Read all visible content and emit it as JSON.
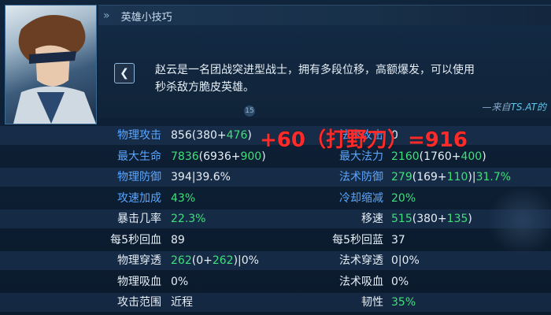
{
  "tips": {
    "header_title": "英雄小技巧",
    "description_line1": "赵云是一名团战突进型战士，拥有多段位移，高额爆发，可以使用",
    "description_line2": "秒杀敌方脆皮英雄。",
    "source_prefix": "—来自",
    "source_name": "TS.AT的",
    "badge": "15"
  },
  "overlay_note": "+60（打野刀）=916",
  "stats": {
    "rows": [
      {
        "label_l": "物理攻击",
        "label_l_color": "blue",
        "val_l": [
          [
            "856(380+",
            "white"
          ],
          [
            "476",
            "green"
          ],
          [
            ")",
            "white"
          ]
        ],
        "label_r": "法术攻击",
        "label_r_color": "blue",
        "val_r": [
          [
            "0",
            "white"
          ]
        ]
      },
      {
        "label_l": "最大生命",
        "label_l_color": "blue",
        "val_l": [
          [
            "7836",
            "green"
          ],
          [
            "(6936+",
            "white"
          ],
          [
            "900",
            "green"
          ],
          [
            ")",
            "white"
          ]
        ],
        "label_r": "最大法力",
        "label_r_color": "blue",
        "val_r": [
          [
            "2160",
            "green"
          ],
          [
            "(1760+",
            "white"
          ],
          [
            "400",
            "green"
          ],
          [
            ")",
            "white"
          ]
        ]
      },
      {
        "label_l": "物理防御",
        "label_l_color": "blue",
        "val_l": [
          [
            "394|39.6%",
            "white"
          ]
        ],
        "label_r": "法术防御",
        "label_r_color": "blue",
        "val_r": [
          [
            "279",
            "green"
          ],
          [
            "(169+",
            "white"
          ],
          [
            "110",
            "green"
          ],
          [
            ")|",
            "white"
          ],
          [
            "31.7%",
            "green"
          ]
        ]
      },
      {
        "label_l": "攻速加成",
        "label_l_color": "blue",
        "val_l": [
          [
            "43%",
            "green"
          ]
        ],
        "label_r": "冷却缩减",
        "label_r_color": "blue",
        "val_r": [
          [
            "20%",
            "green"
          ]
        ]
      },
      {
        "label_l": "暴击几率",
        "label_l_color": "white",
        "val_l": [
          [
            "22.3%",
            "green"
          ]
        ],
        "label_r": "移速",
        "label_r_color": "white",
        "val_r": [
          [
            "515",
            "green"
          ],
          [
            "(380+",
            "white"
          ],
          [
            "135",
            "green"
          ],
          [
            ")",
            "white"
          ]
        ]
      },
      {
        "label_l": "每5秒回血",
        "label_l_color": "white",
        "val_l": [
          [
            "89",
            "white"
          ]
        ],
        "label_r": "每5秒回蓝",
        "label_r_color": "white",
        "val_r": [
          [
            "37",
            "white"
          ]
        ]
      },
      {
        "label_l": "物理穿透",
        "label_l_color": "white",
        "val_l": [
          [
            "262",
            "green"
          ],
          [
            "(0+",
            "white"
          ],
          [
            "262",
            "green"
          ],
          [
            ")|0%",
            "white"
          ]
        ],
        "label_r": "法术穿透",
        "label_r_color": "white",
        "val_r": [
          [
            "0|0%",
            "white"
          ]
        ]
      },
      {
        "label_l": "物理吸血",
        "label_l_color": "white",
        "val_l": [
          [
            "0%",
            "white"
          ]
        ],
        "label_r": "法术吸血",
        "label_r_color": "white",
        "val_r": [
          [
            "0%",
            "white"
          ]
        ]
      },
      {
        "label_l": "攻击范围",
        "label_l_color": "white",
        "val_l": [
          [
            "近程",
            "white"
          ]
        ],
        "label_r": "韧性",
        "label_r_color": "white",
        "val_r": [
          [
            "35%",
            "green"
          ]
        ]
      }
    ]
  },
  "colors": {
    "blue": "#5aa6ff",
    "green": "#3ee079",
    "white": "#e6eef6",
    "overlay_red": "#ff2b2b"
  },
  "icons": {
    "back": "chevron-left-icon",
    "header": "double-chevron-icon"
  }
}
